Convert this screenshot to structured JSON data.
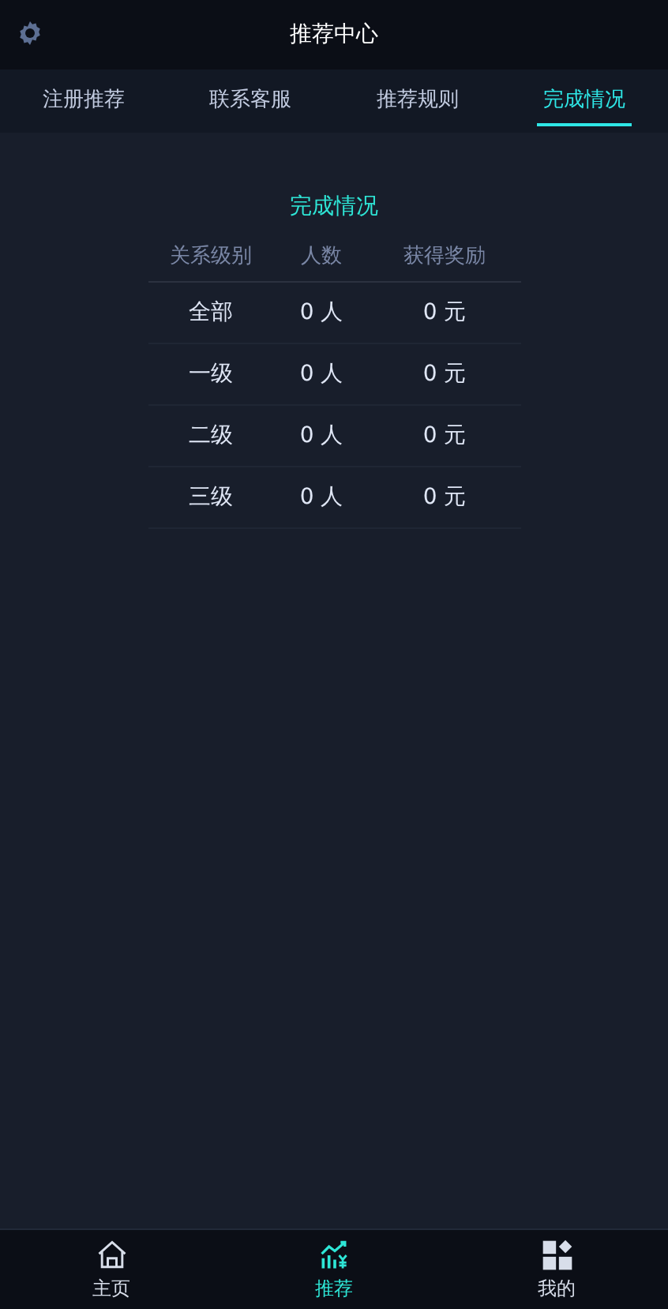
{
  "header": {
    "title": "推荐中心"
  },
  "tabs": [
    {
      "label": "注册推荐",
      "selected": false
    },
    {
      "label": "联系客服",
      "selected": false
    },
    {
      "label": "推荐规则",
      "selected": false
    },
    {
      "label": "完成情况",
      "selected": true
    }
  ],
  "table": {
    "title": "完成情况",
    "columns": [
      "关系级别",
      "人数",
      "获得奖励"
    ],
    "rows": [
      [
        "全部",
        "0 人",
        "0 元"
      ],
      [
        "一级",
        "0 人",
        "0 元"
      ],
      [
        "二级",
        "0 人",
        "0 元"
      ],
      [
        "三级",
        "0 人",
        "0 元"
      ]
    ]
  },
  "bottom_nav": [
    {
      "kind": "home",
      "label": "主页",
      "selected": false
    },
    {
      "kind": "chart",
      "label": "推荐",
      "selected": true
    },
    {
      "kind": "grid",
      "label": "我的",
      "selected": false
    }
  ]
}
